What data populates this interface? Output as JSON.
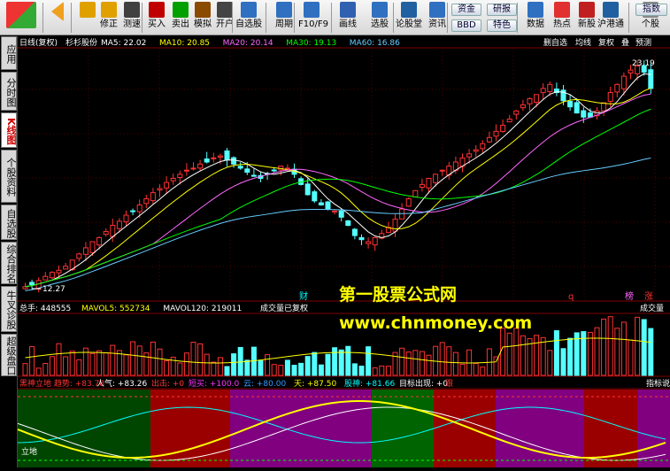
{
  "toolbar": {
    "buttons": [
      {
        "label": "",
        "icon": "windows-icon"
      },
      {
        "label": "",
        "icon": "back-arrow-icon"
      },
      {
        "label": "",
        "icon": "up-down-arrows-icon"
      },
      {
        "label": "修正",
        "icon": "refresh-icon"
      },
      {
        "label": "测速",
        "icon": "clock-icon"
      },
      {
        "label": "买入",
        "icon": "buy-icon"
      },
      {
        "label": "卖出",
        "icon": "sell-icon"
      },
      {
        "label": "模拟",
        "icon": "hammer-icon"
      },
      {
        "label": "开户",
        "icon": "lock-icon"
      },
      {
        "label": "自选股",
        "icon": "star-icon"
      },
      {
        "label": "周期",
        "icon": "period-icon"
      },
      {
        "label": "F10/F9",
        "icon": "f10-icon"
      },
      {
        "label": "画线",
        "icon": "pencil-icon"
      },
      {
        "label": "选股",
        "icon": "select-stock-icon"
      },
      {
        "label": "论股堂",
        "icon": "forum-icon"
      },
      {
        "label": "资讯",
        "icon": "news-icon"
      },
      {
        "label": "数据",
        "icon": "pe-icon"
      },
      {
        "label": "热点",
        "icon": "hot-icon"
      },
      {
        "label": "新股",
        "icon": "new-stock-icon"
      },
      {
        "label": "沪港通",
        "icon": "hk-connect-icon"
      },
      {
        "label": "个股",
        "icon": "stock-icon"
      }
    ],
    "small_buttons": [
      "资金",
      "研报",
      "BBD",
      "特色",
      "指数"
    ],
    "hk_badge": "HK"
  },
  "sidebar": [
    {
      "label": "应用",
      "active": false
    },
    {
      "label": "分时图",
      "active": false
    },
    {
      "label": "K线图",
      "active": true
    },
    {
      "label": "个股资料",
      "active": false
    },
    {
      "label": "自选股",
      "active": false
    },
    {
      "label": "综合排名",
      "active": false
    },
    {
      "label": "牛叉诊股",
      "active": false
    },
    {
      "label": "超级盘口",
      "active": false
    }
  ],
  "price_header": {
    "mode": "日线(复权)",
    "stock": "杉杉股份",
    "ma": [
      {
        "label": "MA5: 22.02",
        "color": "#ffffff"
      },
      {
        "label": "MA10: 20.85",
        "color": "#ffff00"
      },
      {
        "label": "MA20: 20.14",
        "color": "#ff66ff"
      },
      {
        "label": "MA30: 19.13",
        "color": "#00ff00"
      },
      {
        "label": "MA60: 16.86",
        "color": "#66ccff"
      }
    ],
    "right_buttons": [
      "删自选",
      "均线",
      "复权",
      "叠",
      "预测"
    ]
  },
  "price_labels": {
    "high": "23.19",
    "low": "12.27"
  },
  "markers": {
    "cai": "财",
    "q": "q",
    "hui": "榜",
    "zhang": "涨"
  },
  "volume_header": {
    "items": [
      {
        "label": "总手: 448555",
        "color": "#ffffff"
      },
      {
        "label": "MAVOL5: 552734",
        "color": "#ffff00"
      },
      {
        "label": "MAVOL120: 219011",
        "color": "#ffffff"
      }
    ],
    "note": "成交量已复权",
    "right_button": "成交量"
  },
  "indicator_header": {
    "items": [
      {
        "label": "黑神立地 趋势: +83.78",
        "color": "#ff3333"
      },
      {
        "label": "人气: +83.26",
        "color": "#ffffff"
      },
      {
        "label": "出击: +0",
        "color": "#ff3333"
      },
      {
        "label": "短买: +100.0",
        "color": "#ff33ff"
      },
      {
        "label": "云: +80.00",
        "color": "#3399ff"
      },
      {
        "label": "天: +87.50",
        "color": "#ffff00"
      },
      {
        "label": "股神: +81.66",
        "color": "#00ffff"
      },
      {
        "label": "目标出现: +0",
        "color": "#ffffff"
      },
      {
        "label": "跟",
        "color": "#ff3333"
      }
    ],
    "right_button": "指标说",
    "bottom_label": "立地"
  },
  "watermark": {
    "line1": "第一股票公式网",
    "line2": "www.chnmoney.com"
  },
  "colors": {
    "up": "#ff3232",
    "down": "#54ffff",
    "ma5": "#ffffff",
    "ma10": "#ffff00",
    "ma20": "#ff66ff",
    "ma30": "#00ff00",
    "ma60": "#66ccff"
  }
}
